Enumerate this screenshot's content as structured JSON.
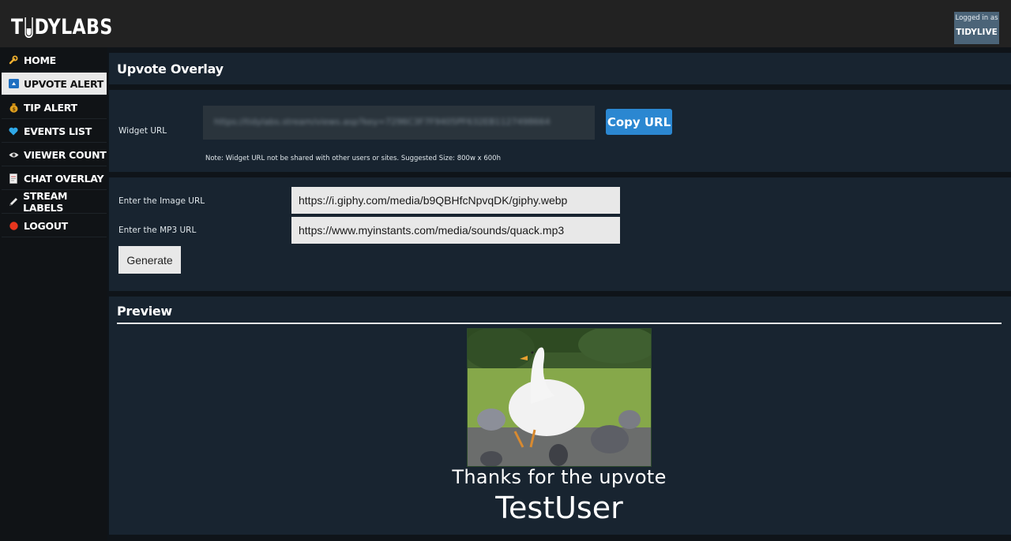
{
  "header": {
    "logo_pre": "T",
    "logo_post": "DYLABS",
    "logged_in_label": "Logged in as",
    "username": "TIDYLIVE"
  },
  "sidebar": {
    "items": [
      {
        "label": "HOME",
        "icon": "wrench-icon"
      },
      {
        "label": "UPVOTE ALERT",
        "icon": "upvote-icon",
        "active": true
      },
      {
        "label": "TIP ALERT",
        "icon": "money-bag-icon"
      },
      {
        "label": "EVENTS LIST",
        "icon": "heart-icon"
      },
      {
        "label": "VIEWER COUNT",
        "icon": "eye-icon"
      },
      {
        "label": "CHAT OVERLAY",
        "icon": "document-icon"
      },
      {
        "label": "STREAM LABELS",
        "icon": "pencil-icon"
      },
      {
        "label": "LOGOUT",
        "icon": "red-circle-icon"
      }
    ]
  },
  "overlay": {
    "title": "Upvote Overlay",
    "widget_url_label": "Widget URL",
    "widget_url_value": "https://tidylabs.stream/views.asp?key=7296C3F7F9405PF632EB1127498664",
    "copy_button": "Copy URL",
    "note": "Note: Widget URL not be shared with other users or sites. Suggested Size: 800w x 600h"
  },
  "form": {
    "image_url_label": "Enter the Image URL",
    "image_url_value": "https://i.giphy.com/media/b9QBHfcNpvqDK/giphy.webp",
    "mp3_url_label": "Enter the MP3 URL",
    "mp3_url_value": "https://www.myinstants.com/media/sounds/quack.mp3",
    "generate_button": "Generate"
  },
  "preview": {
    "title": "Preview",
    "thanks_text": "Thanks for the upvote",
    "user": "TestUser"
  },
  "colors": {
    "accent": "#2b87d1",
    "panel": "#182430",
    "page_bg": "#0f1419",
    "topbar": "#222222",
    "user_box": "#4b6478"
  }
}
